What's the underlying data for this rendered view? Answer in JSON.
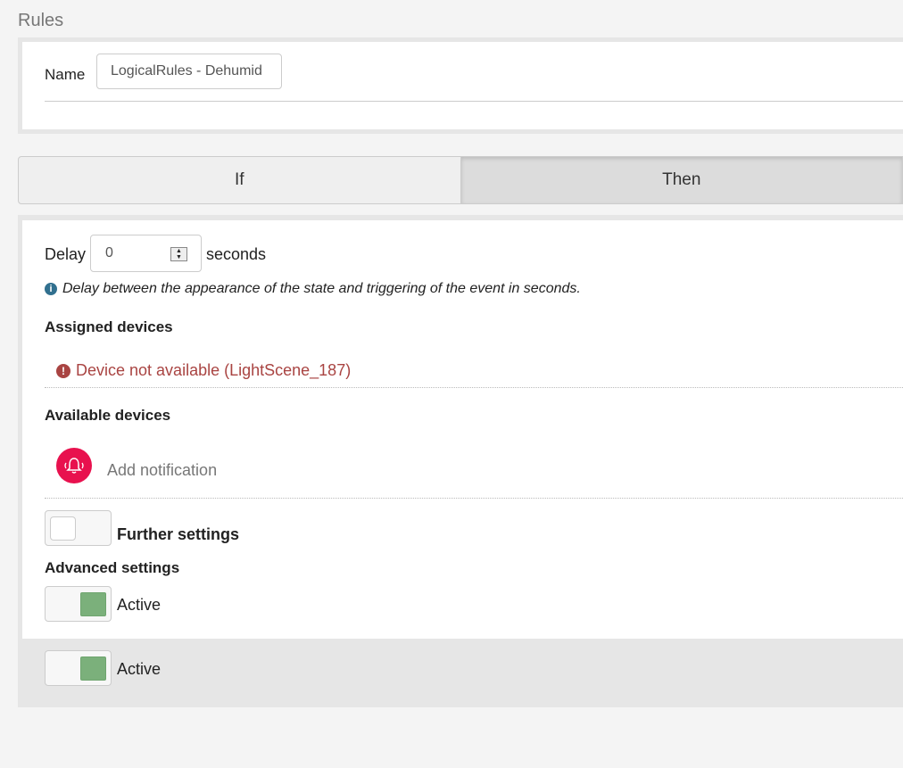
{
  "page": {
    "title": "Rules"
  },
  "name_field": {
    "label": "Name",
    "value": "LogicalRules - Dehumid"
  },
  "tabs": [
    {
      "label": "If",
      "selected": false
    },
    {
      "label": "Then",
      "selected": true
    }
  ],
  "delay": {
    "label": "Delay",
    "value": "0",
    "unit": "seconds",
    "hint": "Delay between the appearance of the state and triggering of the event in seconds."
  },
  "assigned_devices": {
    "heading": "Assigned devices",
    "error": "Device not available (LightScene_187)"
  },
  "available_devices": {
    "heading": "Available devices",
    "items": [
      {
        "label": "Add notification",
        "icon": "bell-alert-icon"
      }
    ]
  },
  "further_settings": {
    "label": "Further settings",
    "enabled": false
  },
  "advanced_settings": {
    "heading": "Advanced settings",
    "active_label": "Active",
    "enabled": true
  },
  "footer": {
    "active_label": "Active",
    "enabled": true
  },
  "colors": {
    "toggle_on": "#7bb07b",
    "error": "#a94442",
    "notification": "#e8114e",
    "info": "#31708f"
  }
}
